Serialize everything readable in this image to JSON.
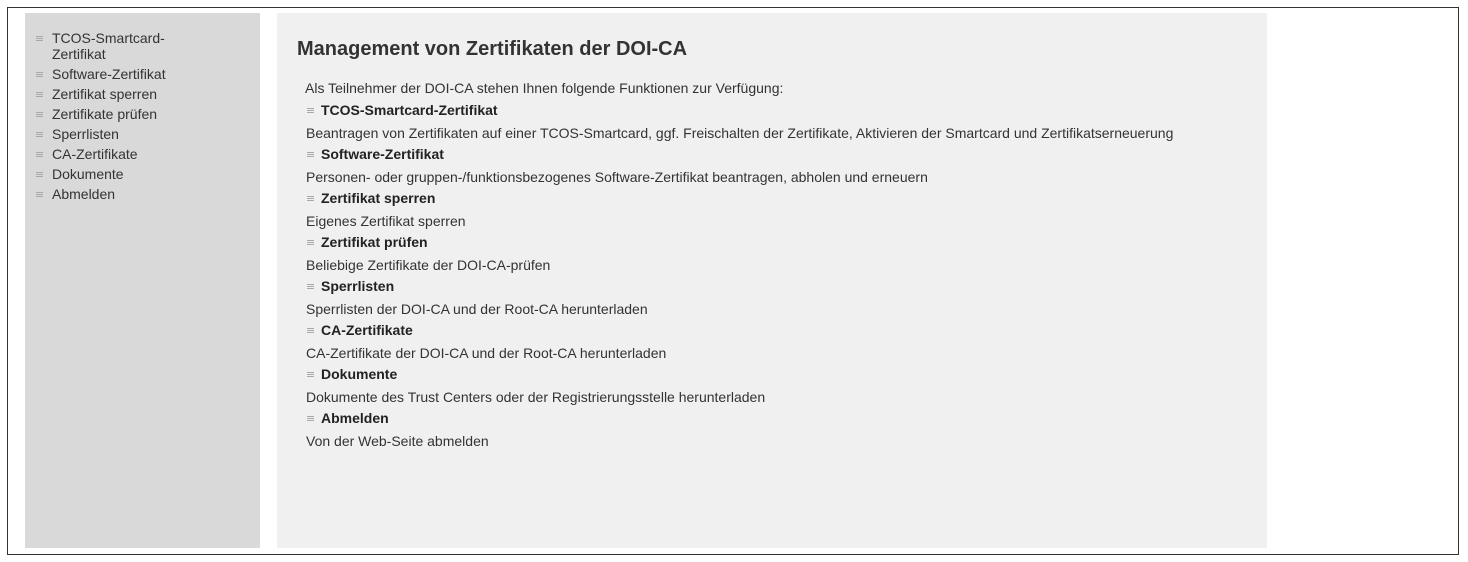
{
  "sidebar": {
    "items": [
      {
        "label": "TCOS-Smartcard-Zertifikat"
      },
      {
        "label": "Software-Zertifikat"
      },
      {
        "label": "Zertifikat sperren"
      },
      {
        "label": "Zertifikate prüfen"
      },
      {
        "label": "Sperrlisten"
      },
      {
        "label": "CA-Zertifikate"
      },
      {
        "label": "Dokumente"
      },
      {
        "label": "Abmelden"
      }
    ]
  },
  "main": {
    "title": "Management von Zertifikaten der DOI-CA",
    "intro": "Als Teilnehmer der DOI-CA stehen Ihnen folgende Funktionen zur Verfügung:",
    "functions": [
      {
        "title": "TCOS-Smartcard-Zertifikat",
        "description": "Beantragen von Zertifikaten auf einer TCOS-Smartcard, ggf. Freischalten der Zertifikate, Aktivieren der Smartcard und Zertifikatserneuerung"
      },
      {
        "title": "Software-Zertifikat",
        "description": "Personen- oder gruppen-/funktionsbezogenes Software-Zertifikat beantragen, abholen und erneuern"
      },
      {
        "title": "Zertifikat sperren",
        "description": "Eigenes Zertifikat sperren"
      },
      {
        "title": "Zertifikat prüfen",
        "description": "Beliebige Zertifikate der DOI-CA-prüfen"
      },
      {
        "title": "Sperrlisten",
        "description": "Sperrlisten der DOI-CA und der Root-CA herunterladen"
      },
      {
        "title": "CA-Zertifikate",
        "description": "CA-Zertifikate der DOI-CA und der Root-CA herunterladen"
      },
      {
        "title": "Dokumente",
        "description": "Dokumente des Trust Centers oder der Registrierungsstelle herunterladen"
      },
      {
        "title": "Abmelden",
        "description": "Von der Web-Seite abmelden"
      }
    ]
  },
  "colors": {
    "sidebar_bg": "#d9d9d9",
    "content_bg": "#f0f0f0",
    "bullet": "#a8a8a8",
    "border": "#333333"
  }
}
